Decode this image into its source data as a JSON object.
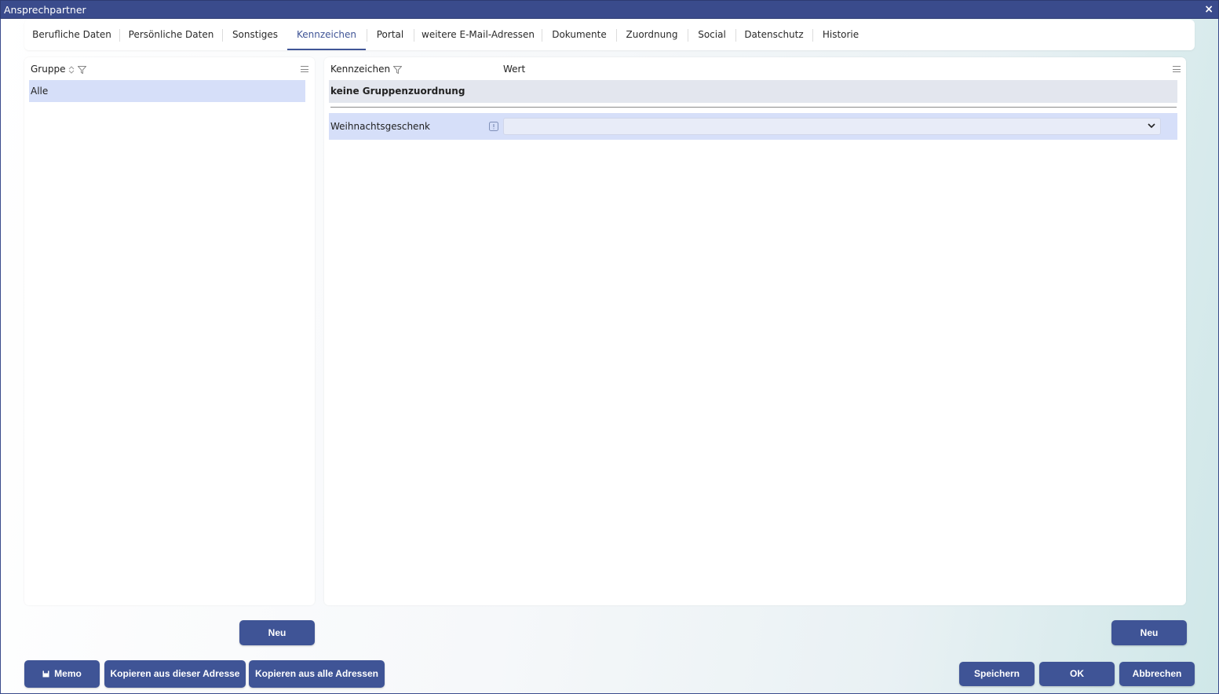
{
  "window": {
    "title": "Ansprechpartner",
    "close_glyph": "×"
  },
  "tabs": [
    {
      "label": "Berufliche Daten"
    },
    {
      "label": "Persönliche Daten"
    },
    {
      "label": "Sonstiges"
    },
    {
      "label": "Kennzeichen",
      "active": true
    },
    {
      "label": "Portal"
    },
    {
      "label": "weitere E-Mail-Adressen"
    },
    {
      "label": "Dokumente"
    },
    {
      "label": "Zuordnung"
    },
    {
      "label": "Social"
    },
    {
      "label": "Datenschutz"
    },
    {
      "label": "Historie"
    }
  ],
  "left_panel": {
    "column_header": "Gruppe",
    "rows": [
      {
        "label": "Alle",
        "selected": true
      }
    ],
    "new_button": "Neu"
  },
  "right_panel": {
    "col_kennzeichen": "Kennzeichen",
    "col_wert": "Wert",
    "group_label": "keine Gruppenzuordnung",
    "items": [
      {
        "label": "Weihnachtsgeschenk",
        "value": ""
      }
    ],
    "new_button": "Neu"
  },
  "footer": {
    "memo": "Memo",
    "copy_this": "Kopieren aus dieser Adresse",
    "copy_all": "Kopieren aus alle Adressen",
    "save": "Speichern",
    "ok": "OK",
    "cancel": "Abbrechen"
  },
  "colors": {
    "accent": "#3f5496",
    "titlebar": "#3a4b8c",
    "selected_row": "#d6dff9",
    "group_row": "#e3e6ee"
  },
  "icons": [
    "close-icon",
    "sort-icon",
    "filter-icon",
    "menu-icon",
    "info-icon",
    "chevron-down-icon",
    "memo-icon"
  ]
}
